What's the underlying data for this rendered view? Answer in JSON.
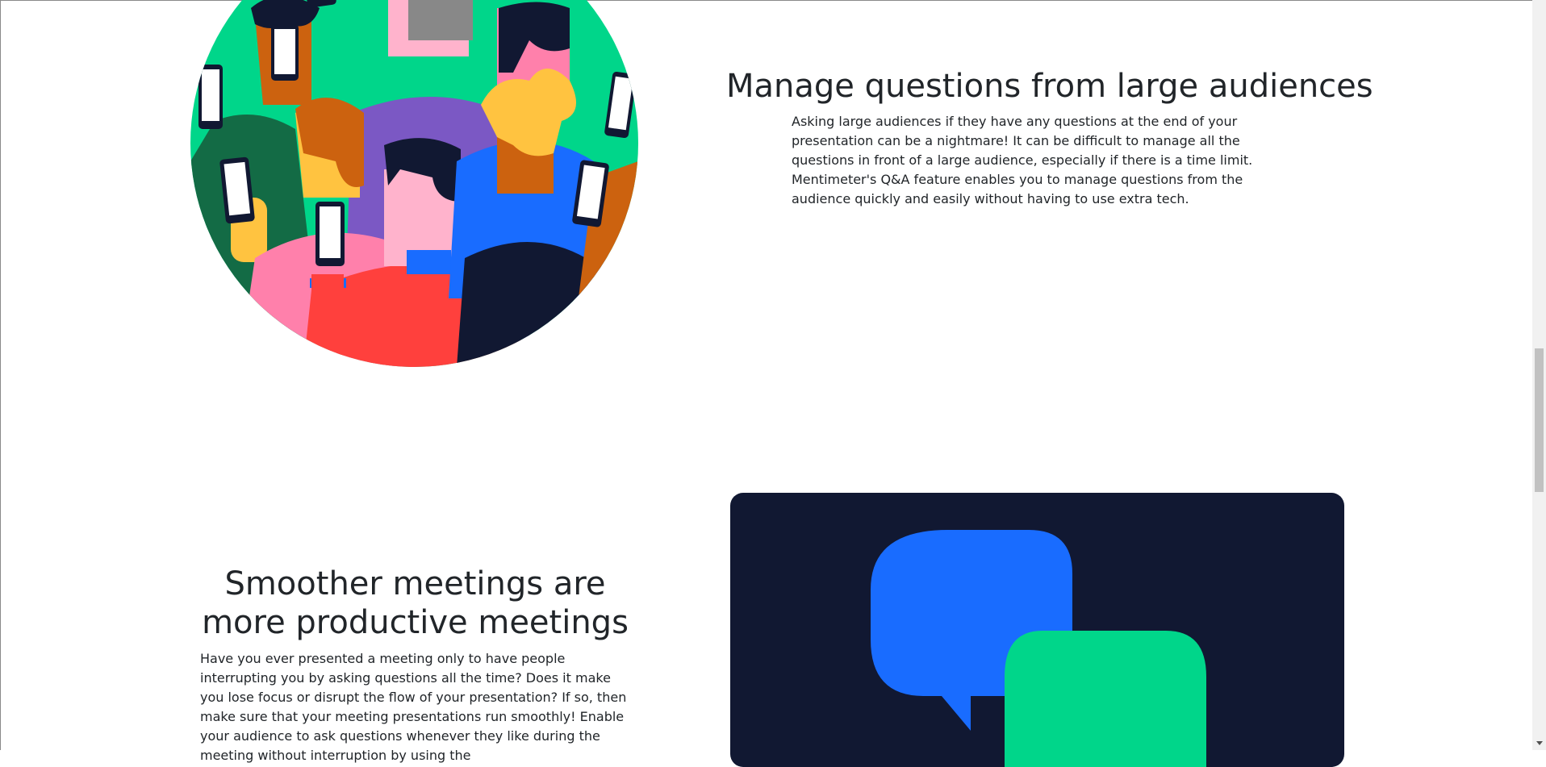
{
  "section1": {
    "title": "Manage questions from large audiences",
    "text": "Asking large audiences if they have any questions at the end of your presentation can be a nightmare! It can be difficult to manage all the questions in front of a large audience, especially if there is a time limit. Mentimeter's Q&A feature enables you to manage questions from the audience quickly and easily without having to use extra tech."
  },
  "section2": {
    "title": "Smoother meetings are more productive meetings",
    "text": "Have you ever presented a meeting only to have people interrupting you by asking questions all the time? Does it make you lose focus or disrupt the flow of your presentation? If so, then make sure that your meeting presentations run smoothly! Enable your audience to ask questions whenever they like during the meeting without interruption by using the"
  },
  "icons": {
    "audience_illustration": "audience-with-phones-illustration",
    "chat_illustration": "chat-bubbles-illustration",
    "scroll_down": "chevron-down-icon"
  },
  "colors": {
    "navy": "#111832",
    "blue": "#196CFF",
    "green": "#00D68A",
    "red": "#FF403D",
    "pink": "#FF80AB",
    "purple": "#7B58C4",
    "orange": "#CC620F",
    "yellow": "#FFC340"
  }
}
